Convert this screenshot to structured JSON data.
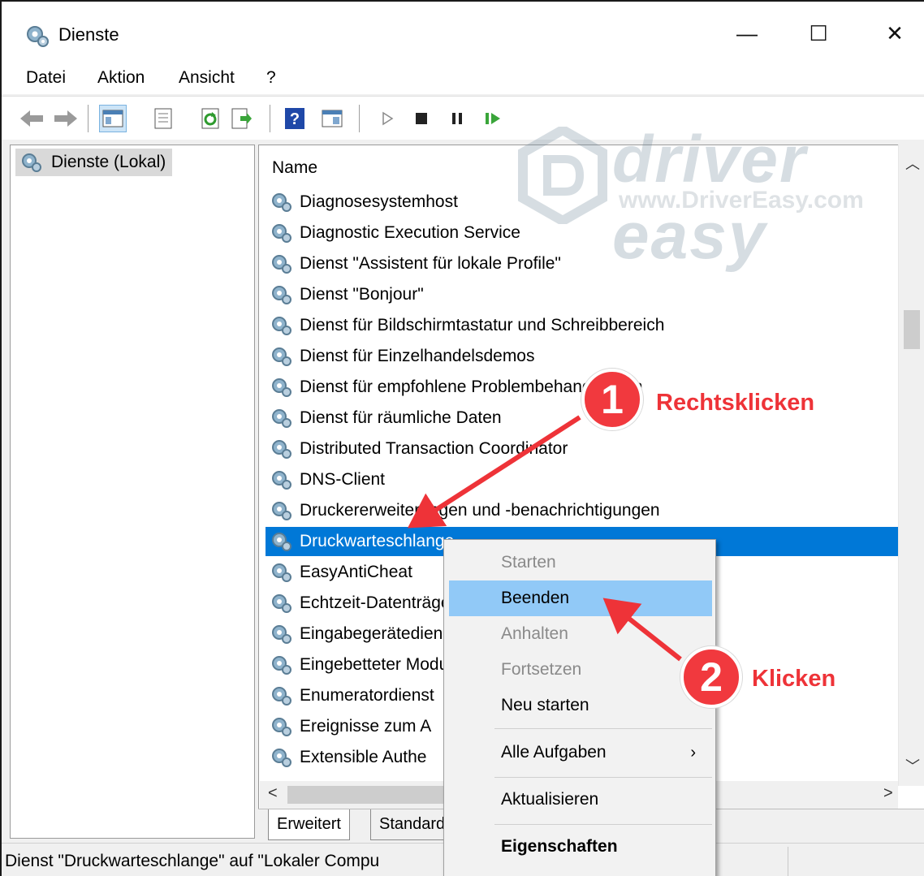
{
  "window": {
    "title": "Dienste",
    "controls": {
      "minimize": "—",
      "maximize": "☐",
      "close": "✕"
    }
  },
  "menu": [
    "Datei",
    "Aktion",
    "Ansicht",
    "?"
  ],
  "tree": {
    "root": "Dienste (Lokal)"
  },
  "list": {
    "column": "Name",
    "rows": [
      "Diagnosesystemhost",
      "Diagnostic Execution Service",
      "Dienst \"Assistent für lokale Profile\"",
      "Dienst \"Bonjour\"",
      "Dienst für Bildschirmtastatur und Schreibbereich",
      "Dienst für Einzelhandelsdemos",
      "Dienst für empfohlene Problembehandlungen",
      "Dienst für räumliche Daten",
      "Distributed Transaction Coordinator",
      "DNS-Client",
      "Druckererweiterungen und -benachrichtigungen",
      "Druckwarteschlange",
      "EasyAntiCheat",
      "Echtzeit-Datenträger",
      "Eingabegerätedienst",
      "Eingebetteter Modus",
      "Enumeratordienst",
      "Ereignisse zum A",
      "Extensible Authe"
    ],
    "selected_index": 11
  },
  "tabs": [
    "Erweitert",
    "Standard"
  ],
  "status": "Dienst \"Druckwarteschlange\" auf \"Lokaler Compu",
  "context_menu": {
    "items": [
      {
        "label": "Starten",
        "state": "disabled"
      },
      {
        "label": "Beenden",
        "state": "hover"
      },
      {
        "label": "Anhalten",
        "state": "disabled"
      },
      {
        "label": "Fortsetzen",
        "state": "disabled"
      },
      {
        "label": "Neu starten",
        "state": "normal"
      },
      {
        "label": "Alle Aufgaben",
        "state": "normal",
        "submenu": "›"
      },
      {
        "label": "Aktualisieren",
        "state": "normal"
      },
      {
        "label": "Eigenschaften",
        "state": "bold"
      }
    ]
  },
  "annotations": {
    "step1": {
      "number": "1",
      "label": "Rechtsklicken"
    },
    "step2": {
      "number": "2",
      "label": "Klicken"
    },
    "color": "#f1393e"
  },
  "watermark": {
    "brand": "driver easy",
    "url": "www.DriverEasy.com"
  },
  "colors": {
    "selection": "#0078d7",
    "menu_hover": "#91c9f7"
  }
}
